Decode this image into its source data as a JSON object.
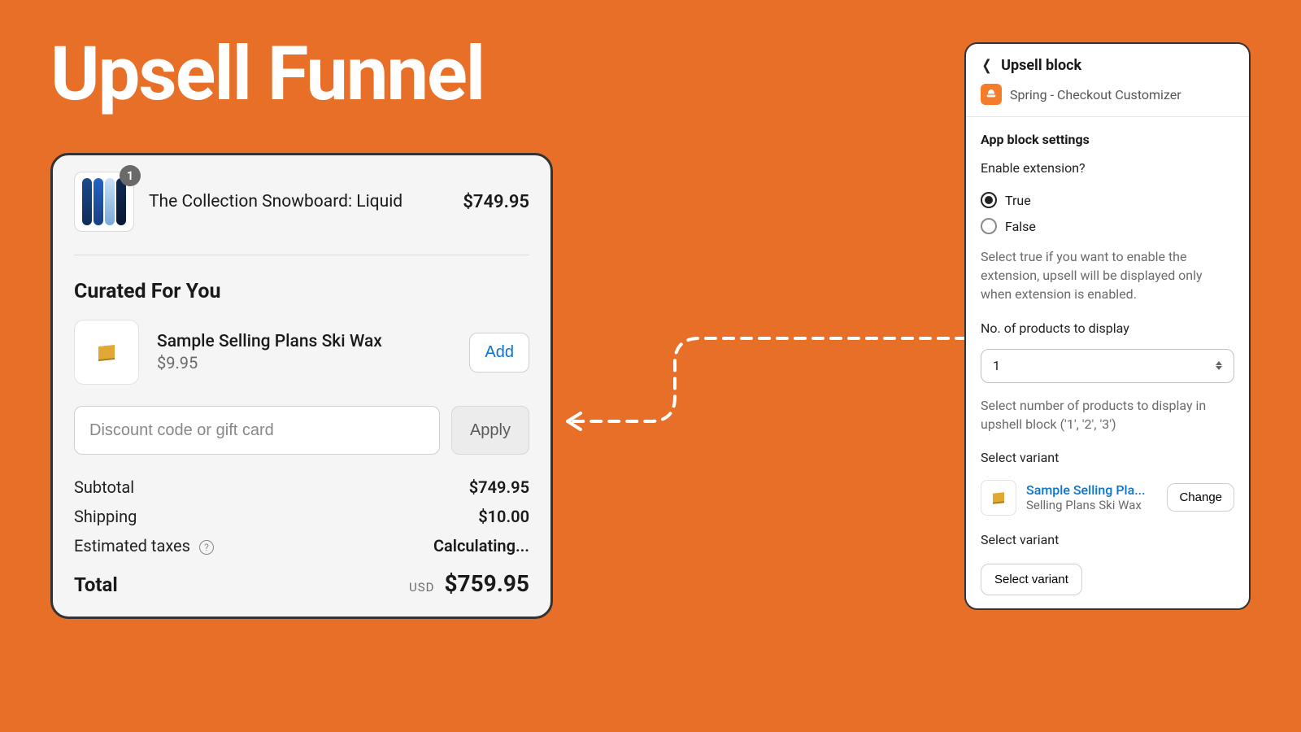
{
  "page": {
    "title": "Upsell Funnel"
  },
  "checkout": {
    "item": {
      "name": "The Collection Snowboard: Liquid",
      "qty": "1",
      "price": "$749.95"
    },
    "curated_title": "Curated For You",
    "upsell": {
      "name": "Sample Selling Plans Ski Wax",
      "price": "$9.95",
      "add_label": "Add"
    },
    "discount_placeholder": "Discount code or gift card",
    "apply_label": "Apply",
    "subtotal_label": "Subtotal",
    "subtotal_value": "$749.95",
    "shipping_label": "Shipping",
    "shipping_value": "$10.00",
    "tax_label": "Estimated taxes",
    "tax_value": "Calculating...",
    "total_label": "Total",
    "total_currency": "USD",
    "total_value": "$759.95"
  },
  "settings": {
    "header": "Upsell block",
    "app_name": "Spring - Checkout Customizer",
    "section_title": "App block settings",
    "enable_question": "Enable extension?",
    "radio_true": "True",
    "radio_false": "False",
    "enable_help": "Select true if you want to enable the extension, upsell will be displayed only when extension is enabled.",
    "count_label": "No. of products to display",
    "count_value": "1",
    "count_help": "Select number of products to display in upshell block ('1', '2', '3')",
    "variant_label": "Select variant",
    "variant_name": "Sample Selling Pla...",
    "variant_sub": "Selling Plans Ski Wax",
    "change_label": "Change",
    "variant_label2": "Select variant",
    "select_variant_btn": "Select variant"
  }
}
